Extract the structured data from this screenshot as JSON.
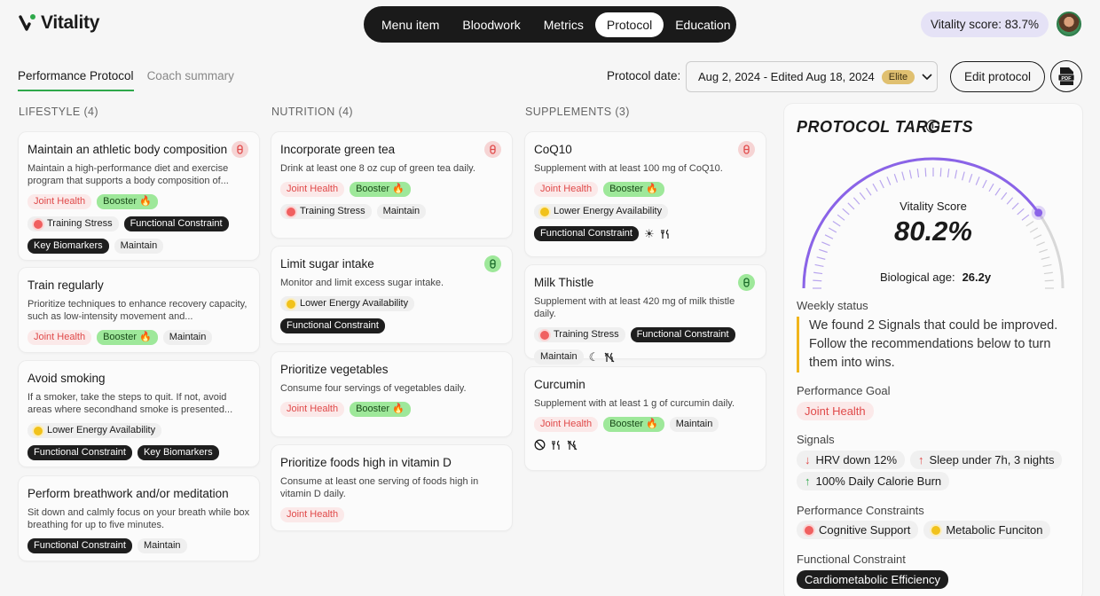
{
  "brand": {
    "name": "Vitality",
    "accent": "#2ea84a"
  },
  "nav": {
    "items": [
      "Menu item",
      "Bloodwork",
      "Metrics",
      "Protocol",
      "Education"
    ],
    "active": "Protocol"
  },
  "header": {
    "score_label": "Vitality score: 83.7%"
  },
  "tabs": {
    "items": [
      "Performance Protocol",
      "Coach summary"
    ],
    "active": "Performance Protocol"
  },
  "protocol_date": {
    "label": "Protocol date:",
    "value": "Aug 2, 2024 - Edited Aug 18, 2024",
    "badge": "Elite"
  },
  "actions": {
    "edit": "Edit protocol",
    "pdf": "PDF"
  },
  "columns": {
    "lifestyle": {
      "title": "LIFESTYLE (4)",
      "cards": [
        {
          "title": "Maintain an athletic body composition",
          "desc": "Maintain a high-performance diet and exercise program that supports a body composition of...",
          "badge": "red"
        },
        {
          "title": "Train regularly",
          "desc": "Prioritize techniques to enhance recovery capacity, such as low-intensity movement and..."
        },
        {
          "title": "Avoid smoking",
          "desc": "If a smoker, take the steps to quit. If not, avoid areas where secondhand smoke is presented..."
        },
        {
          "title": "Perform breathwork and/or meditation",
          "desc": "Sit down and calmly focus on your breath while box breathing for up to five minutes."
        }
      ]
    },
    "nutrition": {
      "title": "NUTRITION (4)",
      "cards": [
        {
          "title": "Incorporate green tea",
          "desc": "Drink at least one 8 oz cup of green tea daily.",
          "badge": "red"
        },
        {
          "title": "Limit sugar intake",
          "desc": "Monitor and limit excess sugar intake.",
          "badge": "green"
        },
        {
          "title": "Prioritize vegetables",
          "desc": "Consume four servings of vegetables daily."
        },
        {
          "title": "Prioritize foods high in vitamin D",
          "desc": "Consume at least one serving of foods high in vitamin D daily."
        }
      ]
    },
    "supplements": {
      "title": "SUPPLEMENTS (3)",
      "cards": [
        {
          "title": "CoQ10",
          "desc": "Supplement with at least 100 mg of CoQ10.",
          "badge": "red"
        },
        {
          "title": "Milk Thistle",
          "desc": "Supplement with at least 420 mg of milk thistle daily.",
          "badge": "green"
        },
        {
          "title": "Curcumin",
          "desc": "Supplement with at least 1 g of curcumin daily."
        }
      ]
    }
  },
  "tags": {
    "joint_health": "Joint Health",
    "booster": "Booster 🔥",
    "training_stress": "Training Stress",
    "functional_constraint": "Functional Constraint",
    "key_biomarkers": "Key Biomarkers",
    "maintain": "Maintain",
    "lower_energy": "Lower Energy Availability"
  },
  "targets": {
    "title": "PROTOCOL TARGETS",
    "score_label": "Vitality Score",
    "score_value": "80.2%",
    "score_fraction": 0.802,
    "bio_label": "Biological age:",
    "bio_value": "26.2y",
    "weekly_label": "Weekly status",
    "weekly_text": "We found 2 Signals that could be improved. Follow the recommendations below to turn them into wins.",
    "goal_label": "Performance Goal",
    "goal": "Joint Health",
    "signals_label": "Signals",
    "signals": [
      "HRV down 12%",
      "Sleep under 7h, 3 nights",
      "100% Daily Calorie Burn"
    ],
    "constraints_label": "Performance Constraints",
    "constraints": [
      "Cognitive Support",
      "Metabolic Funciton"
    ],
    "functional_label": "Functional Constraint",
    "functional": "Cardiometabolic Efficiency",
    "gauge_color": "#8a63e8"
  }
}
